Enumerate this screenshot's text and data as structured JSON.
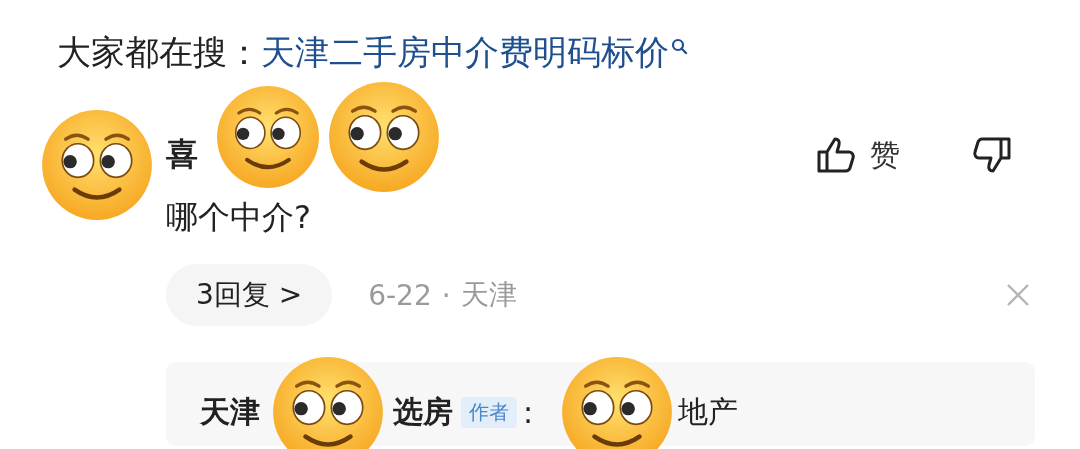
{
  "hot_search": {
    "label": "大家都在搜：",
    "query": "天津二手房中介费明码标价"
  },
  "comment": {
    "author": "喜",
    "text": "哪个中介?",
    "like_label": "赞",
    "replies_button": "3回复 >",
    "date": "6-22",
    "separator": "·",
    "location": "天津",
    "reply": {
      "author_parts": [
        "天津",
        "选房"
      ],
      "badge": "作者",
      "colon": ":",
      "text": "地产"
    }
  },
  "stickers": [
    {
      "kind": "flushed-emoji"
    },
    {
      "kind": "flushed-emoji"
    },
    {
      "kind": "flushed-emoji"
    },
    {
      "kind": "flushed-emoji"
    },
    {
      "kind": "flushed-emoji"
    }
  ]
}
